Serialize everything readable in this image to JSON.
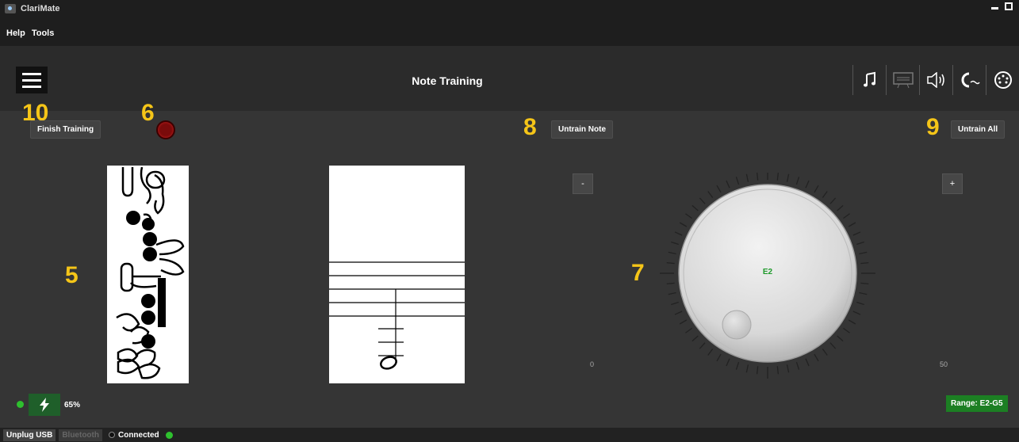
{
  "window": {
    "title": "ClariMate"
  },
  "menu": {
    "help": "Help",
    "tools": "Tools"
  },
  "header": {
    "title": "Note Training"
  },
  "toolbar_icons": [
    "music-note-icon",
    "keyboard-icon",
    "speaker-icon",
    "wave-icon",
    "midi-icon"
  ],
  "buttons": {
    "finish_training": "Finish Training",
    "untrain_note": "Untrain Note",
    "untrain_all": "Untrain All",
    "minus": "-",
    "plus": "+"
  },
  "callouts": {
    "c10": "10",
    "c6": "6",
    "c8": "8",
    "c9": "9",
    "c5": "5",
    "c7": "7"
  },
  "knob": {
    "note": "E2",
    "min_label": "0",
    "max_label": "50"
  },
  "battery": {
    "percent": "65%"
  },
  "range": {
    "label": "Range: E2-G5"
  },
  "status": {
    "unplug": "Unplug USB",
    "bluetooth": "Bluetooth",
    "connected": "Connected"
  },
  "colors": {
    "accent_green": "#1c7f23",
    "callout": "#f5c518",
    "record": "#7a0b0b"
  }
}
